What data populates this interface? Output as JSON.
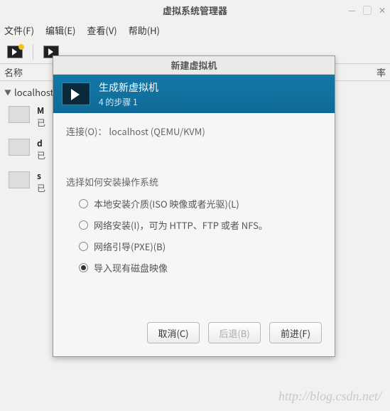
{
  "main": {
    "title": "虚拟系统管理器",
    "win_controls": {
      "min": "—",
      "max": "▢",
      "close": "✕"
    }
  },
  "menu": {
    "file": "文件(F)",
    "edit": "编辑(E)",
    "view": "查看(V)",
    "help": "帮助(H)"
  },
  "columns": {
    "name": "名称",
    "rate": "率"
  },
  "host": "localhost",
  "vms": [
    {
      "name": "M",
      "status": "已"
    },
    {
      "name": "d",
      "status": "已"
    },
    {
      "name": "s",
      "status": "已"
    }
  ],
  "dialog": {
    "title": "新建虚拟机",
    "header": {
      "title": "生成新虚拟机",
      "step": "4 的步骤 1"
    },
    "connection_label": "连接(O)：",
    "connection_value": "localhost (QEMU/KVM)",
    "choose_label": "选择如何安装操作系统",
    "options": [
      "本地安装介质(ISO 映像或者光驱)(L)",
      "网络安装(I)，可为 HTTP、FTP 或者 NFS。",
      "网络引导(PXE)(B)",
      "导入现有磁盘映像"
    ],
    "selected_index": 3,
    "buttons": {
      "cancel": "取消(C)",
      "back": "后退(B)",
      "forward": "前进(F)"
    }
  },
  "watermark": "http://blog.csdn.net/"
}
